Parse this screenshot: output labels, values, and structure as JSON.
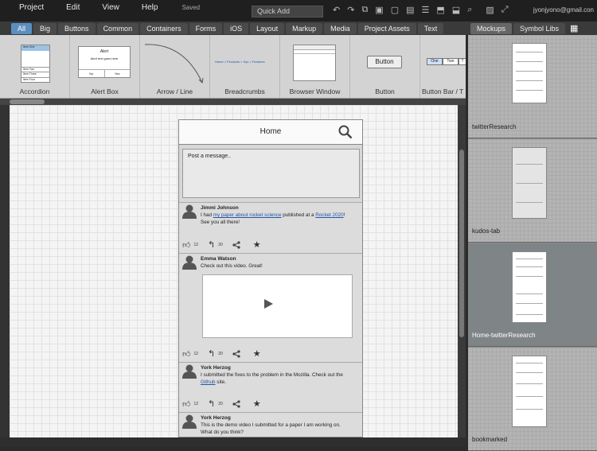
{
  "menu": {
    "items": [
      "Project",
      "Edit",
      "View",
      "Help"
    ],
    "saved": "Saved",
    "quick_add": "Quick Add",
    "email": "jyonjyono@gmail.con"
  },
  "tabs": [
    "All",
    "Big",
    "Buttons",
    "Common",
    "Containers",
    "Forms",
    "iOS",
    "Layout",
    "Markup",
    "Media",
    "Project Assets",
    "Text"
  ],
  "right_tabs": [
    "Mockups",
    "Symbol Libs"
  ],
  "library": [
    {
      "label": "Accordion"
    },
    {
      "label": "Alert Box",
      "title": "Alert",
      "body": "Alert text goes here",
      "no": "No",
      "yes": "Yes"
    },
    {
      "label": "Arrow / Line"
    },
    {
      "label": "Breadcrumbs",
      "crumbs": "Home > Products > Xyz > Features"
    },
    {
      "label": "Browser Window"
    },
    {
      "label": "Button",
      "button_text": "Button"
    },
    {
      "label": "Button Bar / T",
      "bar": [
        "One",
        "Two",
        "T"
      ]
    }
  ],
  "accordion_items": [
    "Item One",
    "Item Two",
    "Item Three",
    "Item Four"
  ],
  "phone": {
    "title": "Home",
    "post_placeholder": "Post a message..",
    "posts": [
      {
        "name": "Jimmi Johnson",
        "pre": "I had ",
        "link1": "my paper about rocket science",
        "mid": " published at a ",
        "link2": "Rocket 2020",
        "post": "! See you all there!",
        "likes": "12",
        "replies": "20"
      },
      {
        "name": "Emma Watson",
        "text": "Check out this video. Great!",
        "likes": "12",
        "replies": "20"
      },
      {
        "name": "York Herzog",
        "pre": "I submitted the fixes to the problem in the Mozilla. Check out the ",
        "link1": "Github",
        "post": " site.",
        "likes": "12",
        "replies": "20"
      },
      {
        "name": "York Herzog",
        "text": "This is the demo video I submitted for a paper I am working on. What do you think?"
      }
    ]
  },
  "mockups": [
    "twitterResearch",
    "kudos-tab",
    "Home-twitterResearch",
    "bookmarked"
  ]
}
